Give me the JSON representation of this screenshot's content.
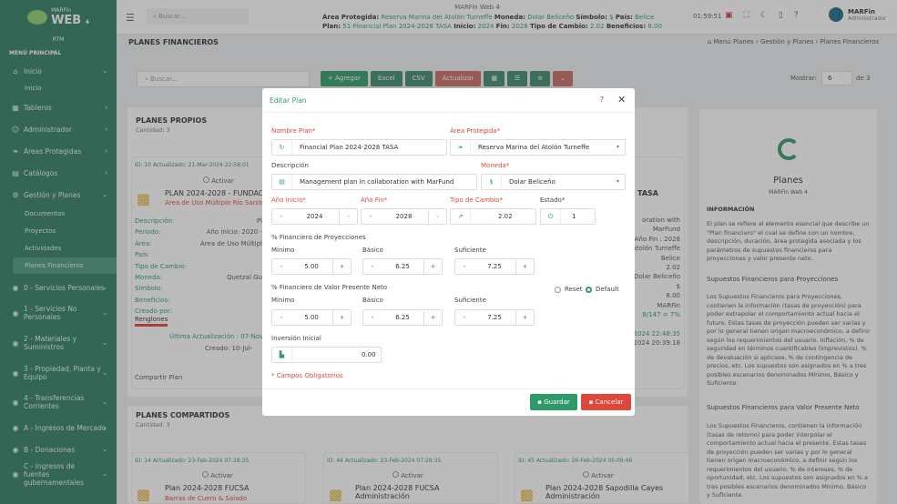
{
  "app": {
    "logo_text": "MARFin",
    "logo_big": "WEB",
    "logo_ver": "4",
    "org": "RTM",
    "menu_header": "MENÚ PRINCIPAL"
  },
  "sidebar": {
    "items": [
      {
        "label": "Inicio",
        "icon": "home-icon"
      },
      {
        "label": "Tableros",
        "icon": "chart-icon"
      },
      {
        "label": "Administrador",
        "icon": "user-icon"
      },
      {
        "label": "Áreas Protegidas",
        "icon": "leaf-icon"
      },
      {
        "label": "Catálogos",
        "icon": "folder-icon"
      },
      {
        "label": "Gestión y Planes",
        "icon": "gear-icon"
      },
      {
        "label": "0 - Servicios Personales",
        "icon": "coins-icon"
      },
      {
        "label": "1 - Servicios No Personales",
        "icon": "coins-icon"
      },
      {
        "label": "2 - Materiales y Suministros",
        "icon": "coins-icon"
      },
      {
        "label": "3 - Propiedad, Planta y Equipo",
        "icon": "coins-icon"
      },
      {
        "label": "4 - Transferencias Corrientes",
        "icon": "coins-icon"
      },
      {
        "label": "A - Ingresos de Mercado",
        "icon": "coins-icon"
      },
      {
        "label": "B - Donaciones",
        "icon": "coins-icon"
      },
      {
        "label": "C - Ingresos de fuentes gubernamentales",
        "icon": "coins-icon"
      }
    ],
    "sub_inicio": "Inicio",
    "sub_gestion": [
      "Documentos",
      "Proyectos",
      "Actividades",
      "Planes Financieros"
    ]
  },
  "topbar": {
    "search_placeholder": "Buscar...",
    "center": "MARFin Web 4",
    "l1_lbl1": "Área Protegida:",
    "l1_val1": "Reserva Marina del Atolón Turneffe",
    "l1_lbl2": "Moneda:",
    "l1_val2": "Dolar Beliceño",
    "l1_lbl3": "Símbolo:",
    "l1_val3": "$",
    "l1_lbl4": "País:",
    "l1_val4": "Belice",
    "l2_lbl1": "Plan:",
    "l2_val1": "51-Financial Plan 2024-2028 TASA",
    "l2_lbl2": "Inicio:",
    "l2_val2": "2024",
    "l2_lbl3": "Fin:",
    "l2_val3": "2028",
    "l2_lbl4": "Tipo de Cambio:",
    "l2_val4": "2.02",
    "l2_lbl5": "Beneficios:",
    "l2_val5": "8.00",
    "clock": "01:59:51",
    "user_name": "MARFin",
    "user_role": "Administrador"
  },
  "page": {
    "title": "PLANES FINANCIEROS",
    "crumb": [
      "Menú Planes",
      "Gestión y Planes",
      "Planes Financieros"
    ],
    "search_placeholder": "Buscar...",
    "toolbar": [
      "Agregar",
      "Excel",
      "CSV",
      "Actualizar"
    ],
    "mostrar": "Mostrar:",
    "mostrar_val": "6",
    "de": "de 3",
    "own_title": "PLANES PROPIOS",
    "own_count": "Cantidad: 3",
    "shared_title": "PLANES COMPARTIDOS",
    "shared_count": "Cantidad: 3"
  },
  "bgcards": {
    "c1_id": "ID: 10 Actualizado: 21-Mar-2024 22:58:01",
    "c1_activar": "Activar",
    "c1_title": "PLAN 2024-2028 - FUNDAC",
    "c1_sub": "Área de Uso Múltiple Río Sarstún",
    "c1_fields": [
      "Descripción:",
      "Periodo:",
      "Área:",
      "País:",
      "Tipo de Cambio:",
      "Moneda:",
      "Símbolo:",
      "Beneficios:",
      "Creado por:"
    ],
    "c1_vals": [
      "Pl",
      "Año inicio: 2020 -",
      "Área de Uso Múltipl",
      "",
      "",
      "Quetzal Gu",
      "",
      "",
      ""
    ],
    "c1_renglones": "Renglones",
    "c1_last": "Última Actualización : 07-Nov-",
    "c1_created": "Creado:",
    "c1_created_val": "10-Jul-",
    "compartir": "Compartir Plan",
    "s1_id": "ID: 14 Actualizado: 23-Feb-2024 07:28:35",
    "s1_activar": "Activar",
    "s1_title": "Plan 2024-2028 FUCSA",
    "s1_sub": "Barras de Cuero & Salado",
    "s2_id": "ID: 44 Actualizado: 23-Feb-2024 07:28:35",
    "s2_activar": "Activar",
    "s2_title": "Plan 2024-2028 FUCSA Administración",
    "s3_id": "ID: 45 Actualizado: 26-Feb-2024 05:09:46",
    "s3_activar": "Activar",
    "s3_title": "Plan 2024-2028 Sapodilla Cayes Administración",
    "c2_title": "TASA",
    "c2_vals": [
      "oration with",
      "MarFund",
      "Año Fin : 2028",
      "atolón Turneffe",
      "Belice",
      "2.02",
      "Dolar Beliceño",
      "$",
      "8.00",
      "MARFin",
      "8/147 = 7%",
      "-2024 22:48:35",
      "-2024 20:39:18"
    ]
  },
  "modal": {
    "title": "Editar Plan",
    "help": "?",
    "nombre_label": "Nombre Plan*",
    "nombre_val": "Financial Plan 2024-2028 TASA",
    "area_label": "Área Protegida*",
    "area_val": "Reserva Marina del Atolón Turneffe",
    "desc_label": "Descripción",
    "desc_val": "Management plan in collaboration with MarFund",
    "moneda_label": "Moneda*",
    "moneda_val": "Dolar Beliceño",
    "inicio_label": "Año Inicio*",
    "inicio_val": "2024",
    "fin_label": "Año Fin*",
    "fin_val": "2028",
    "tipo_label": "Tipo de Cambio*",
    "tipo_val": "2.02",
    "estado_label": "Estado*",
    "estado_val": "1",
    "proy_label": "% Financiero de Proyecciones",
    "vpn_label": "% Financiero de Valor Presente Neto",
    "min_label": "Mínimo",
    "bas_label": "Básico",
    "suf_label": "Suficiente",
    "proy_vals": [
      "5.00",
      "6.25",
      "7.25"
    ],
    "vpn_vals": [
      "5.00",
      "6.25",
      "7.25"
    ],
    "reset": "Reset",
    "default": "Default",
    "inv_label": "Inversión Inicial",
    "inv_val": "0.00",
    "req": "* Campos Obligatorios",
    "save": "Guardar",
    "cancel": "Cancelar"
  },
  "sidepanel": {
    "title": "Planes",
    "sub": "MARFin Web 4",
    "h1": "INFORMACIÓN",
    "p1": "El plan se refiere al elemento esencial que describe un \"Plan financiero\" el cual se define con un nombre, descripción, duración, área protegida asociada y los parámetros de supuestos financieros para proyecciones y valor presente neto.",
    "h2": "Supuestos Financieros para Proyecciones",
    "p2": "Los Supuestos Financieros para Proyecciones, contienen la información (tasas de proyección) para poder extrapolar el comportamiento actual hacia el futuro. Estas tasas de proyección pueden ser varias y por lo general tienen origen macroeconómico, a definir según los requerimientos del usuario. Inflación, % de seguridad en términos cuantificables (imprevistos), % de devaluación si aplicase, % de contingencia de precios, etc. Los supuestos son asignados en % a tres posibles escenarios denominados Mínimo, Básico y Suficiente.",
    "h3": "Supuestos Financieros para Valor Presente Neto",
    "p3": "Los Supuestos Financieros, contienen la información (tasas de retorno) para poder interpolar el comportamiento actual hacia el presente. Estas tasas de proyección pueden ser varias y por lo general tienen origen macroeconómico, a definir según los requerimientos del usuario. % de intereses, % de oportunidad, etc. Los supuestos son asignados en % a tres posibles escenarios denominados Mínimo, Básico y Suficiente."
  }
}
